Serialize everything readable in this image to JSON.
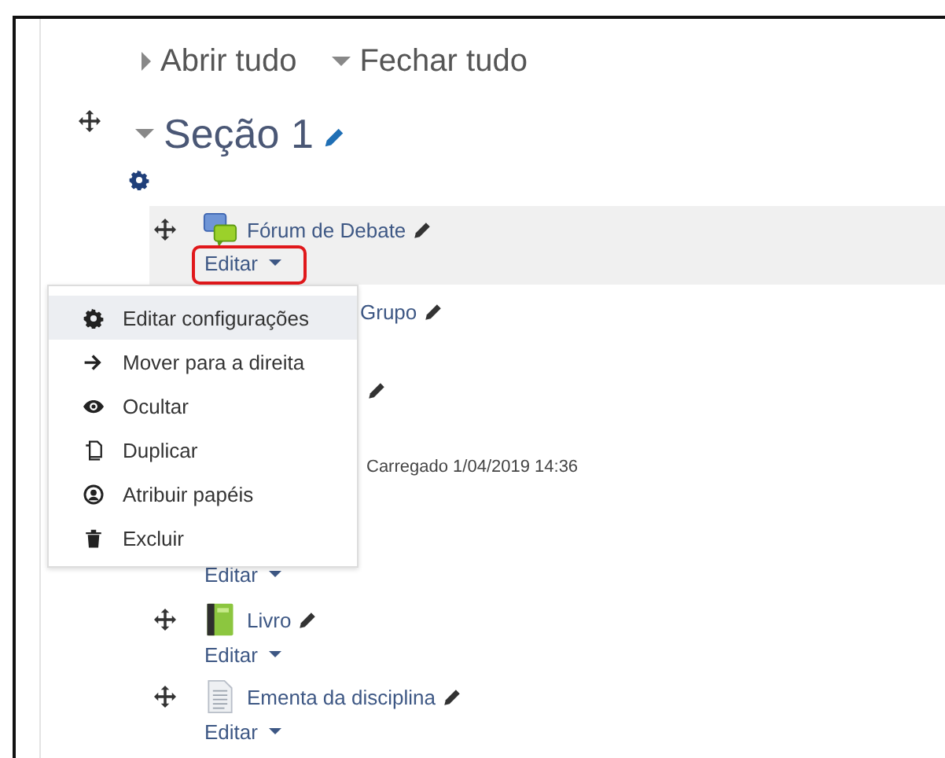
{
  "toolbar": [
    {
      "label": "Abrir tudo",
      "expanded": false
    },
    {
      "label": "Fechar tudo",
      "expanded": true
    }
  ],
  "section": {
    "title": "Seção 1",
    "expanded": true
  },
  "activities": [
    {
      "kind": "forum",
      "name": "Fórum de Debate",
      "edit_label": "Editar",
      "highlighted": true,
      "outlined": true
    },
    {
      "kind": "covered",
      "name": "Grupo"
    },
    {
      "kind": "covered"
    },
    {
      "kind": "info",
      "info": "Carregado 1/04/2019 14:36",
      "edit_label": "Editar"
    },
    {
      "kind": "book",
      "name": "Livro",
      "edit_label": "Editar",
      "highlighted": false,
      "outlined": false
    },
    {
      "kind": "page",
      "name": "Ementa da disciplina",
      "edit_label": "Editar",
      "highlighted": false,
      "outlined": false
    }
  ],
  "menu": {
    "items": [
      {
        "kind": "gear",
        "label": "Editar configurações",
        "selected": true
      },
      {
        "kind": "arrow",
        "label": "Mover para a direita",
        "selected": false
      },
      {
        "kind": "eye",
        "label": "Ocultar",
        "selected": false
      },
      {
        "kind": "copy",
        "label": "Duplicar",
        "selected": false
      },
      {
        "kind": "user",
        "label": "Atribuir papéis",
        "selected": false
      },
      {
        "kind": "trash",
        "label": "Excluir",
        "selected": false
      }
    ]
  }
}
